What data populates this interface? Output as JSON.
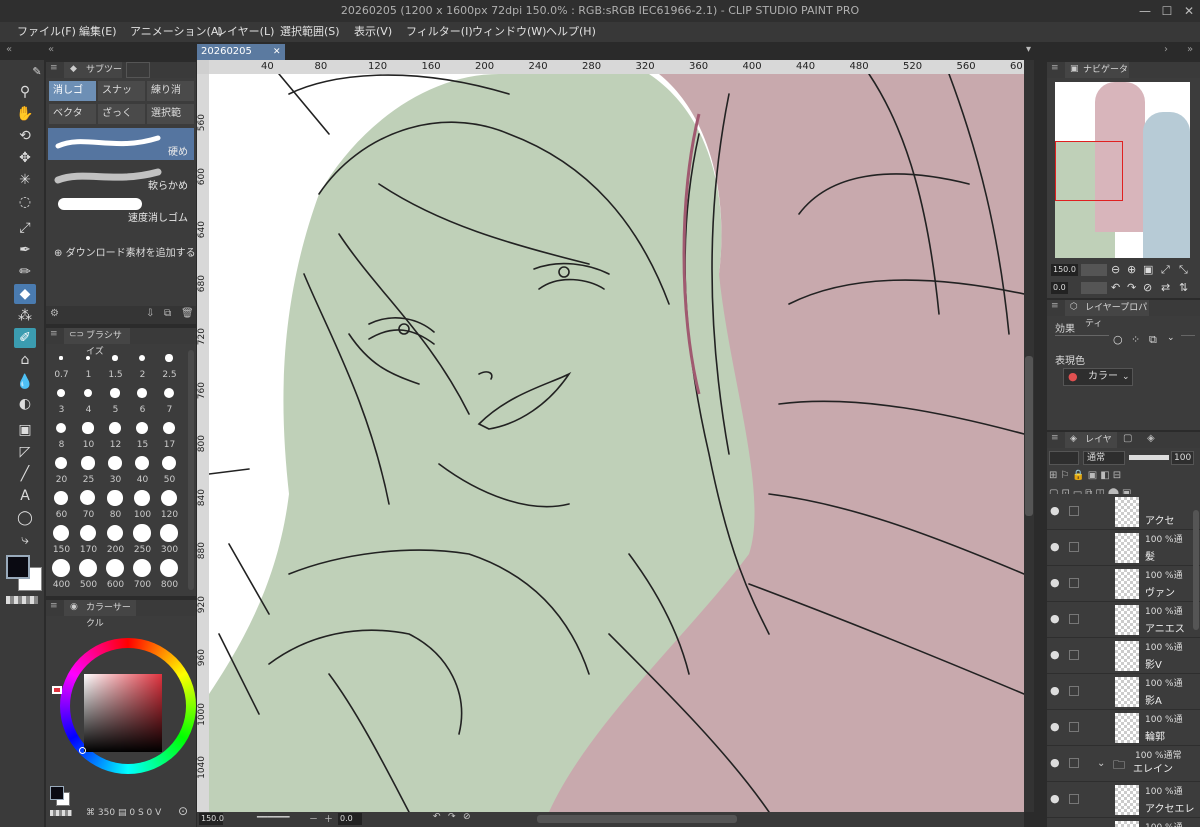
{
  "window": {
    "title": "20260205 (1200 x 1600px 72dpi 150.0% : RGB:sRGB IEC61966-2.1)  - CLIP STUDIO PAINT PRO",
    "minimize": "—",
    "maximize": "☐",
    "close": "✕"
  },
  "menu": [
    "ファイル(F)",
    "編集(E)",
    "アニメーション(A)",
    "レイヤー(L)",
    "選択範囲(S)",
    "表示(V)",
    "フィルター(I)",
    "ウィンドウ(W)",
    "ヘルプ(H)"
  ],
  "document_tab": {
    "name": "20260205",
    "close": "✕"
  },
  "subtool": {
    "header": "サブツール",
    "tabs": [
      "消しゴ",
      "スナッ",
      "練り消",
      "ベクタ",
      "ざっく",
      "選択範"
    ],
    "brushes": [
      "硬め",
      "軟らかめ",
      "速度消しゴム"
    ],
    "add_material": "ダウンロード素材を追加する"
  },
  "brush_size": {
    "header": "ブラシサイズ",
    "sizes": [
      "0.7",
      "1",
      "1.5",
      "2",
      "2.5",
      "3",
      "4",
      "5",
      "6",
      "7",
      "8",
      "10",
      "12",
      "15",
      "17",
      "20",
      "25",
      "30",
      "40",
      "50",
      "60",
      "70",
      "80",
      "100",
      "120",
      "150",
      "170",
      "200",
      "250",
      "300",
      "400",
      "500",
      "600",
      "700",
      "800"
    ]
  },
  "color_circle": {
    "header": "カラーサークル",
    "values": [
      "350",
      "0",
      "0"
    ],
    "value_suffixes": [
      "S",
      "V"
    ]
  },
  "ruler": {
    "horizontal": [
      "40",
      "80",
      "120",
      "160",
      "200",
      "240",
      "280",
      "320",
      "360",
      "400",
      "440",
      "480",
      "520",
      "560",
      "60"
    ],
    "vertical": [
      "560",
      "600",
      "640",
      "680",
      "720",
      "760",
      "800",
      "840",
      "880",
      "920",
      "960",
      "1000",
      "1040"
    ]
  },
  "status": {
    "zoom": "150.0",
    "angle": "0.0"
  },
  "navigator": {
    "header": "ナビゲーター",
    "zoom": "150.0",
    "angle": "0.0"
  },
  "layer_property": {
    "header": "レイヤープロパティ",
    "effect_label": "効果",
    "expression_label": "表現色",
    "expression_value": "カラー"
  },
  "layers": {
    "header": "レイヤー",
    "blend": "通常",
    "opacity": "100",
    "items": [
      {
        "opacity": "",
        "name": "アクセ"
      },
      {
        "opacity": "100 %通",
        "name": "髪"
      },
      {
        "opacity": "100 %通",
        "name": "ヴァン"
      },
      {
        "opacity": "100 %通",
        "name": "アニエス"
      },
      {
        "opacity": "100 %通",
        "name": "影V"
      },
      {
        "opacity": "100 %通",
        "name": "影A"
      },
      {
        "opacity": "100 %通",
        "name": "輪郭"
      },
      {
        "opacity": "100 %通常",
        "name": "エレイン"
      },
      {
        "opacity": "100 %通",
        "name": "アクセエレ"
      },
      {
        "opacity": "100 %通",
        "name": ""
      }
    ]
  },
  "colors": {
    "accent": "#4a7bb0",
    "green_fill": "#bfd0b8",
    "pink_fill": "#c8a9ad",
    "foreground": "#0a0a12"
  }
}
